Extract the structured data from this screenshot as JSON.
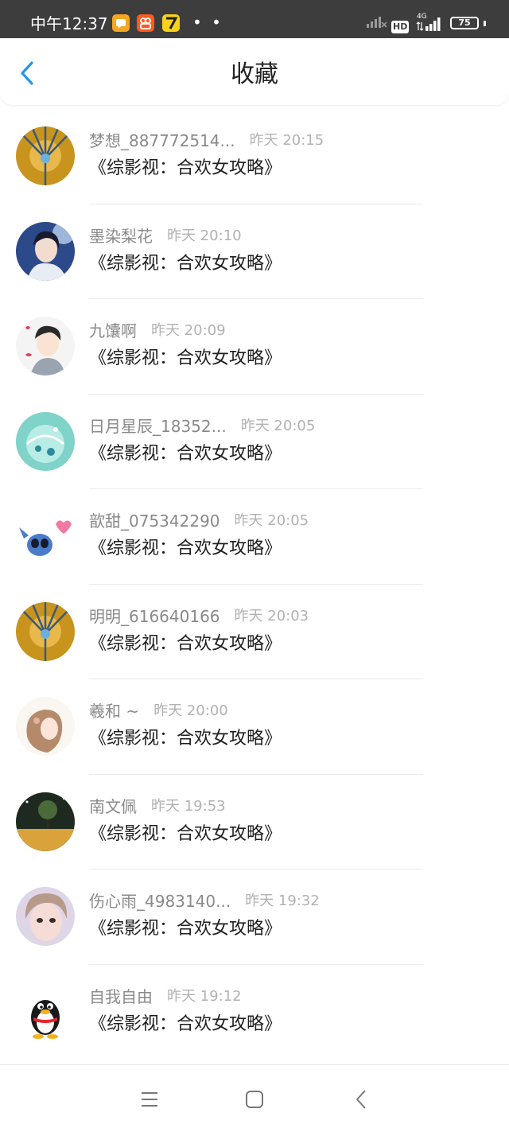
{
  "status_bar": {
    "time": "中午12:37",
    "dots": "• •",
    "hd_label": "HD",
    "network_label": "4G",
    "battery": "75"
  },
  "header": {
    "title": "收藏",
    "back_icon": "chevron-left-icon"
  },
  "favorites": [
    {
      "nickname": "梦想_887772514...",
      "time": "昨天 20:15",
      "book": "《综影视：合欢女攻略》"
    },
    {
      "nickname": "墨染梨花",
      "time": "昨天 20:10",
      "book": "《综影视：合欢女攻略》"
    },
    {
      "nickname": "九馕啊",
      "time": "昨天 20:09",
      "book": "《综影视：合欢女攻略》"
    },
    {
      "nickname": "日月星辰_18352...",
      "time": "昨天 20:05",
      "book": "《综影视：合欢女攻略》"
    },
    {
      "nickname": "歆甜_075342290",
      "time": "昨天 20:05",
      "book": "《综影视：合欢女攻略》"
    },
    {
      "nickname": "明明_616640166",
      "time": "昨天 20:03",
      "book": "《综影视：合欢女攻略》"
    },
    {
      "nickname": "羲和 ~",
      "time": "昨天 20:00",
      "book": "《综影视：合欢女攻略》"
    },
    {
      "nickname": "南文佩",
      "time": "昨天 19:53",
      "book": "《综影视：合欢女攻略》"
    },
    {
      "nickname": "伤心雨_4983140...",
      "time": "昨天 19:32",
      "book": "《综影视：合欢女攻略》"
    },
    {
      "nickname": "自我自由",
      "time": "昨天 19:12",
      "book": "《综影视：合欢女攻略》"
    }
  ],
  "nav_bar": {
    "menu_icon": "menu-icon",
    "home_icon": "home-square-icon",
    "back_icon": "back-triangle-icon"
  },
  "colors": {
    "status_bar_bg": "#3d3d3d",
    "accent": "#2196f3",
    "nickname": "#8a8a8a",
    "timestamp": "#b2b2b2",
    "book_title": "#1e1e1e"
  }
}
